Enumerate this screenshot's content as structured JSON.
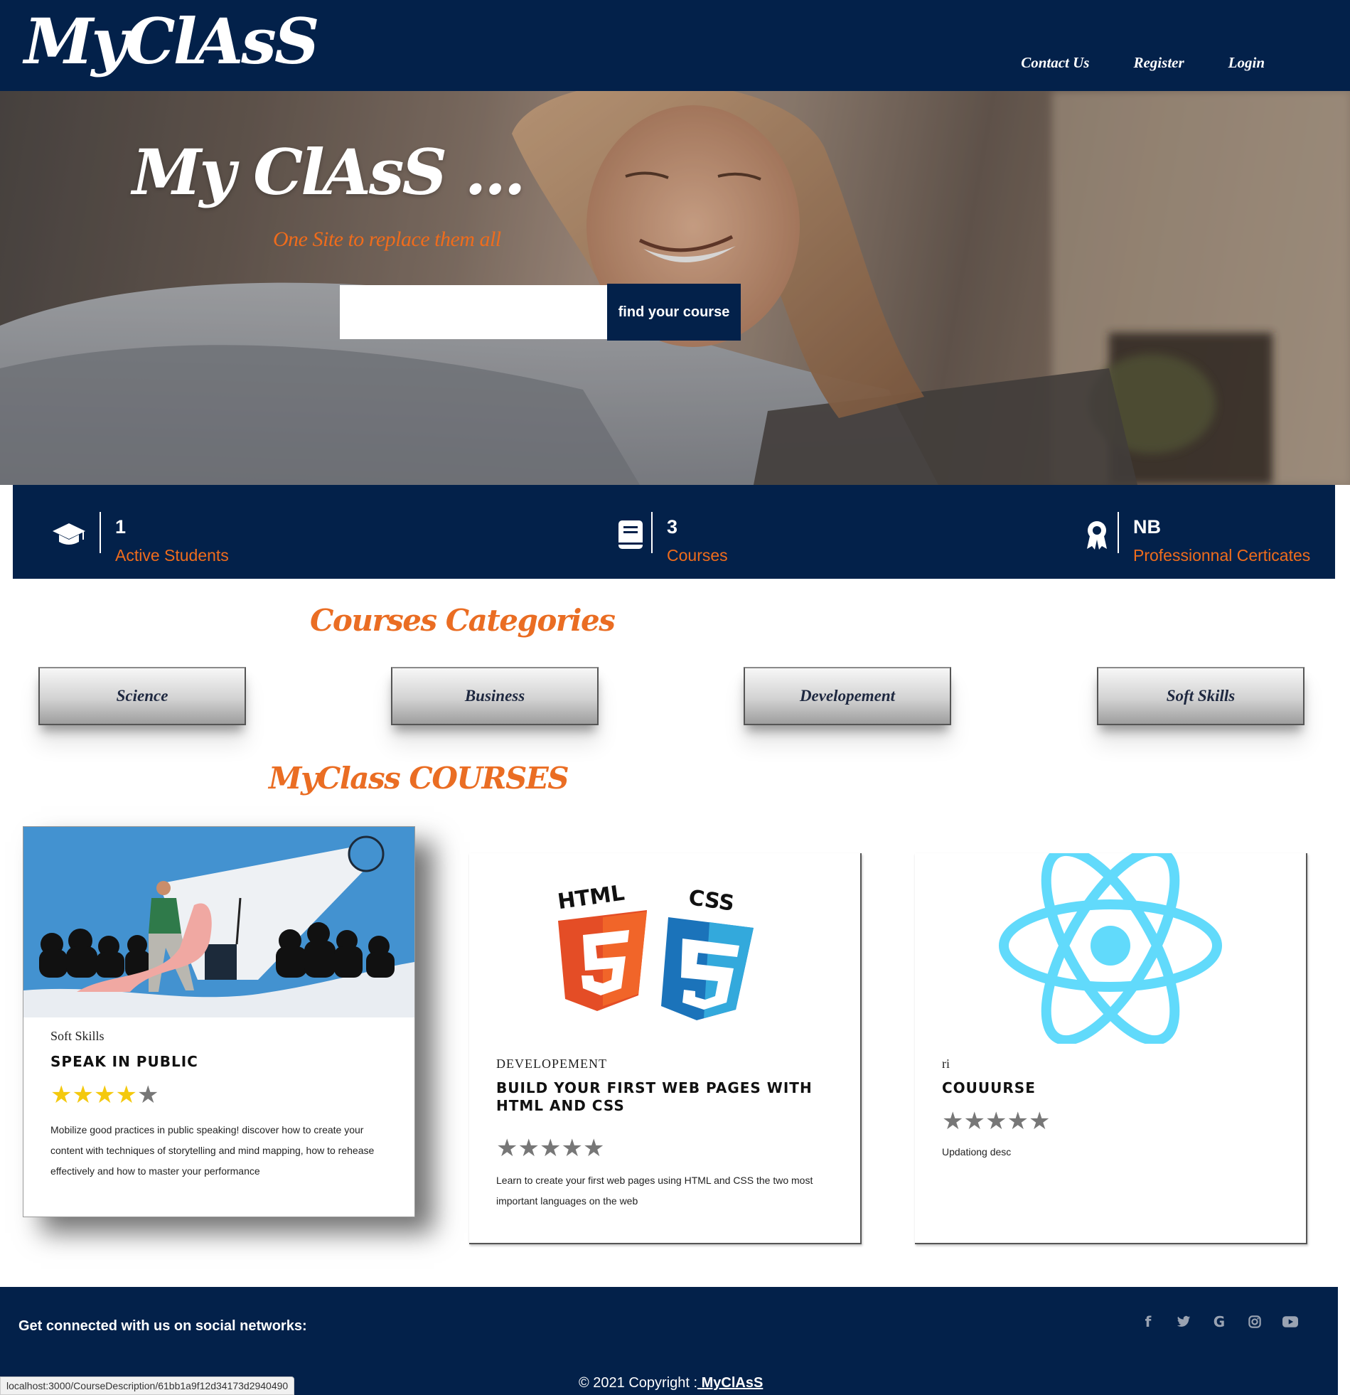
{
  "header": {
    "logo": "MyClAsS",
    "nav": [
      "Contact Us",
      "Register",
      "Login"
    ]
  },
  "hero": {
    "title": "My ClAsS ...",
    "subtitle": "One Site to replace them all",
    "search": {
      "value": "",
      "placeholder": "",
      "button_label": "find your course"
    }
  },
  "stats": [
    {
      "icon": "graduation-cap-icon",
      "value": "1",
      "label": "Active Students"
    },
    {
      "icon": "book-icon",
      "value": "3",
      "label": "Courses"
    },
    {
      "icon": "award-icon",
      "value": "NB",
      "label": "Professionnal Certicates"
    }
  ],
  "categories": {
    "heading": "Courses Categories",
    "items": [
      "Science",
      "Business",
      "Developement",
      "Soft Skills"
    ]
  },
  "courses": {
    "heading": "MyClass COURSES",
    "items": [
      {
        "image": "public-speaking-illustration",
        "category": "Soft Skills",
        "title": "SPEAK IN PUBLIC",
        "rating": 4,
        "rating_max": 5,
        "description": "Mobilize good practices in public speaking! discover how to create your content with techniques of storytelling and mind mapping, how to rehease effectively and how to master your performance"
      },
      {
        "image": "html5-css3-logos",
        "category": "DEVELOPEMENT",
        "title": "BUILD YOUR FIRST WEB PAGES WITH HTML AND CSS",
        "rating": 0,
        "rating_max": 5,
        "description": "Learn to create your first web pages using HTML and CSS the two most important languages on the web"
      },
      {
        "image": "react-logo",
        "category": "ri",
        "title": "COUUURSE",
        "rating": 0,
        "rating_max": 5,
        "description": "Updationg desc"
      }
    ]
  },
  "footer": {
    "social_text": "Get connected with us on social networks:",
    "socials": [
      "facebook-icon",
      "twitter-icon",
      "google-icon",
      "instagram-icon",
      "youtube-icon"
    ],
    "copyright_prefix": "© 2021 Copyright :",
    "copyright_link": " MyClAsS"
  },
  "statusbar": "localhost:3000/CourseDescription/61bb1a9f12d34173d2940490",
  "colors": {
    "navy": "#03214a",
    "orange": "#ea6d23",
    "star": "#f4c90e"
  }
}
